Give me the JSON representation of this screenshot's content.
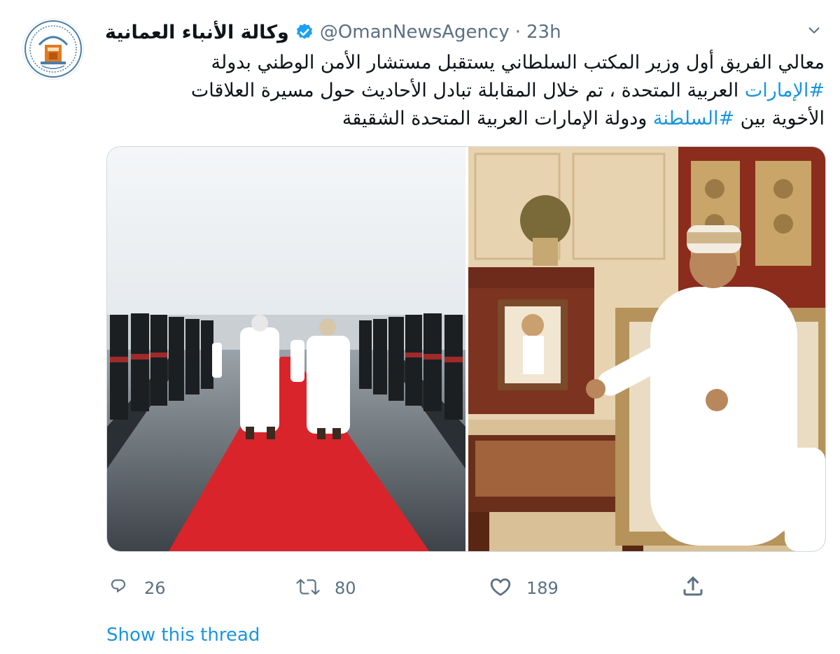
{
  "tweet": {
    "display_name": "وكالة الأنباء العمانية",
    "handle": "@OmanNewsAgency",
    "separator": "·",
    "time": "23h",
    "text_line1": "معالي الفريق أول وزير المكتب السلطاني يستقبل مستشار الأمن الوطني بدولة",
    "hashtag_uae": "#الإمارات",
    "text_line2_rest": " العربية المتحدة ، تم خلال المقابلة تبادل الأحاديث حول مسيرة العلاقات",
    "text_line3_pre": "الأخوية بين ",
    "hashtag_sultanate": "#السلطنة",
    "text_line3_post": " ودولة الإمارات العربية المتحدة الشقيقة"
  },
  "actions": {
    "replies": "26",
    "retweets": "80",
    "likes": "189"
  },
  "footer": {
    "show_thread": "Show this thread"
  },
  "colors": {
    "link": "#1b95e0",
    "secondary_text": "#5b7083",
    "verified": "#1da1f2",
    "carpet_red": "#d9242b"
  },
  "icons": {
    "reply": "reply-icon",
    "retweet": "retweet-icon",
    "like": "heart-icon",
    "share": "share-icon",
    "menu": "chevron-down-icon",
    "verified": "verified-badge-icon"
  }
}
